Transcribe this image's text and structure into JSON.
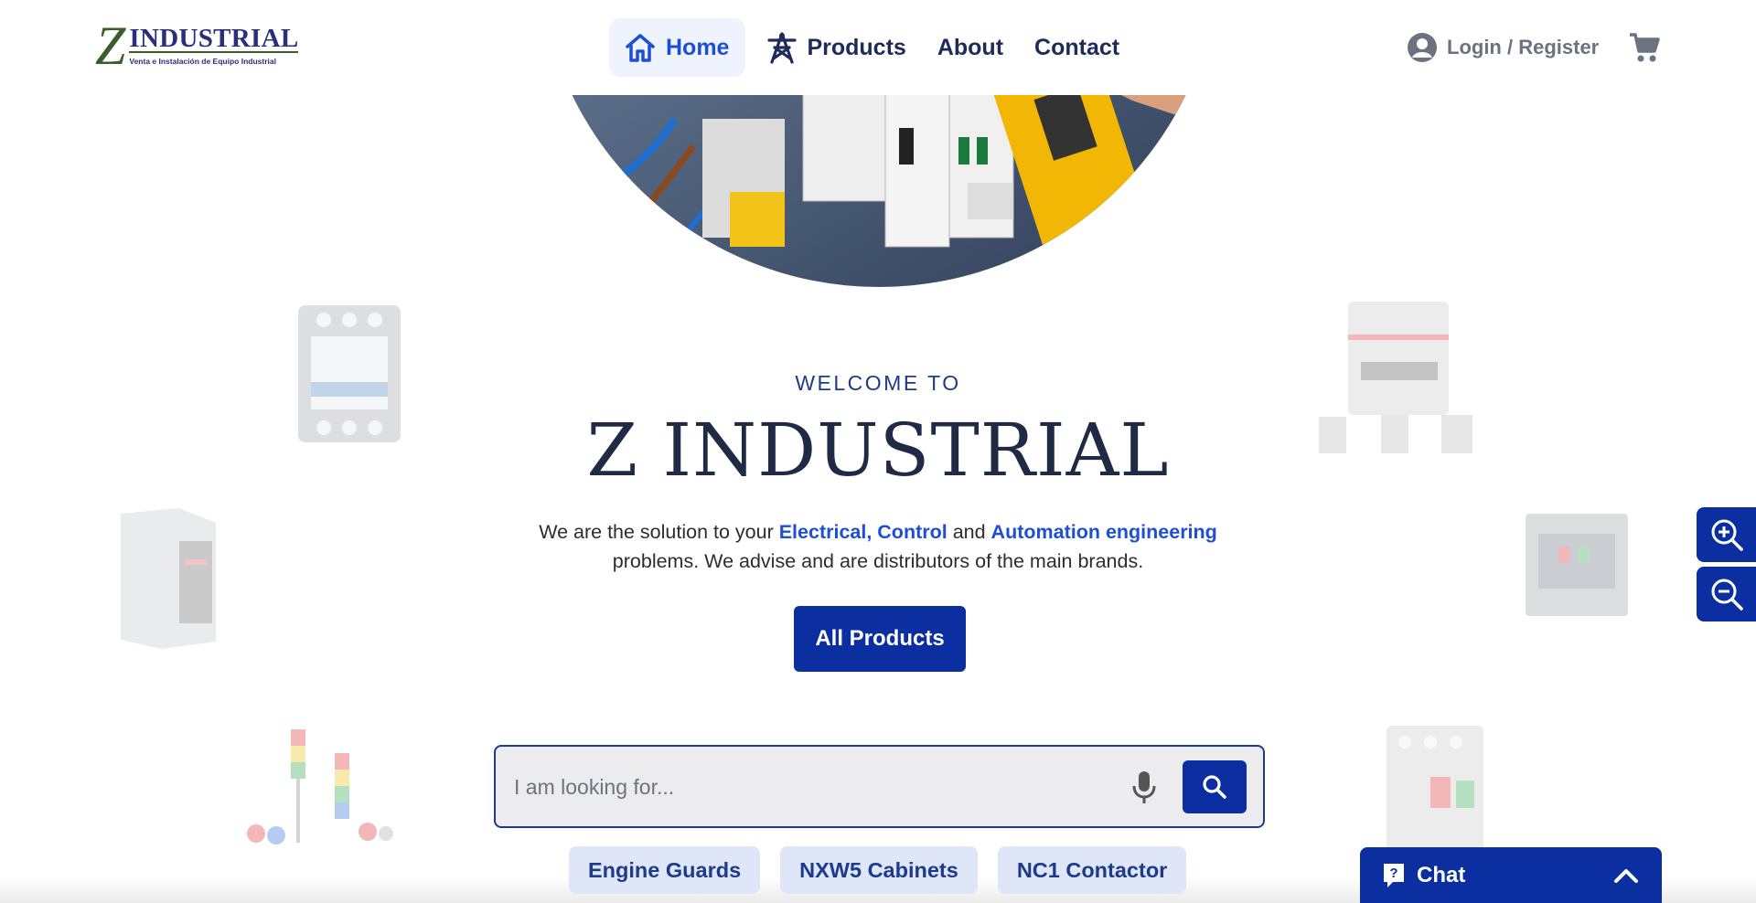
{
  "header": {
    "logo": {
      "letter": "Z",
      "name": "INDUSTRIAL",
      "tagline": "Venta e Instalación de Equipo Industrial"
    },
    "nav": [
      {
        "label": "Home",
        "icon": "home-icon",
        "active": true
      },
      {
        "label": "Products",
        "icon": "tower-icon",
        "active": false
      },
      {
        "label": "About",
        "icon": "",
        "active": false
      },
      {
        "label": "Contact",
        "icon": "",
        "active": false
      }
    ],
    "login_label": "Login / Register",
    "cart_icon": "cart-icon"
  },
  "hero": {
    "welcome": "WELCOME TO",
    "title": "Z INDUSTRIAL",
    "desc_1": "We are the solution to your ",
    "desc_hl_1": "Electrical, Control",
    "desc_2": " and ",
    "desc_hl_2": "Automation engineering",
    "desc_3": "problems. We advise and are distributors of the main brands.",
    "cta_label": "All Products"
  },
  "search": {
    "placeholder": "I am looking for...",
    "value": "",
    "mic_icon": "microphone-icon",
    "button_icon": "search-icon"
  },
  "chips": [
    "Engine Guards",
    "NXW5 Cabinets",
    "NC1 Contactor"
  ],
  "zoom": {
    "in_icon": "zoom-in-icon",
    "out_icon": "zoom-out-icon"
  },
  "chat": {
    "label": "Chat",
    "icon": "chat-help-icon",
    "toggle_icon": "chevron-up-icon"
  },
  "colors": {
    "primary": "#0b2fa0",
    "link": "#1d4ed8",
    "nav_text": "#1e2a5a",
    "chip_bg": "#dfe6f7",
    "logo_green": "#3a5e2a"
  }
}
